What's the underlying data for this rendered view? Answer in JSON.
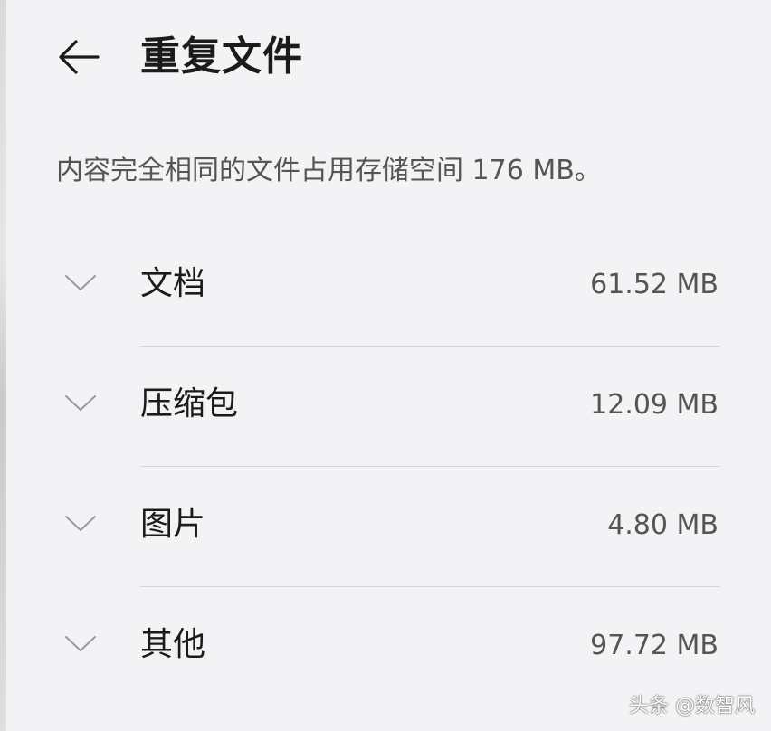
{
  "header": {
    "title": "重复文件",
    "back_icon": "back-arrow-icon"
  },
  "summary": "内容完全相同的文件占用存储空间 176 MB。",
  "categories": [
    {
      "label": "文档",
      "size": "61.52 MB",
      "icon": "chevron-down-icon"
    },
    {
      "label": "压缩包",
      "size": "12.09 MB",
      "icon": "chevron-down-icon"
    },
    {
      "label": "图片",
      "size": "4.80 MB",
      "icon": "chevron-down-icon"
    },
    {
      "label": "其他",
      "size": "97.72 MB",
      "icon": "chevron-down-icon"
    }
  ],
  "watermark": "头条 @数智风",
  "colors": {
    "background": "#f3f3f5",
    "primary_text": "#1b1b1b",
    "secondary_text": "#555555",
    "divider": "#d6d6da"
  }
}
